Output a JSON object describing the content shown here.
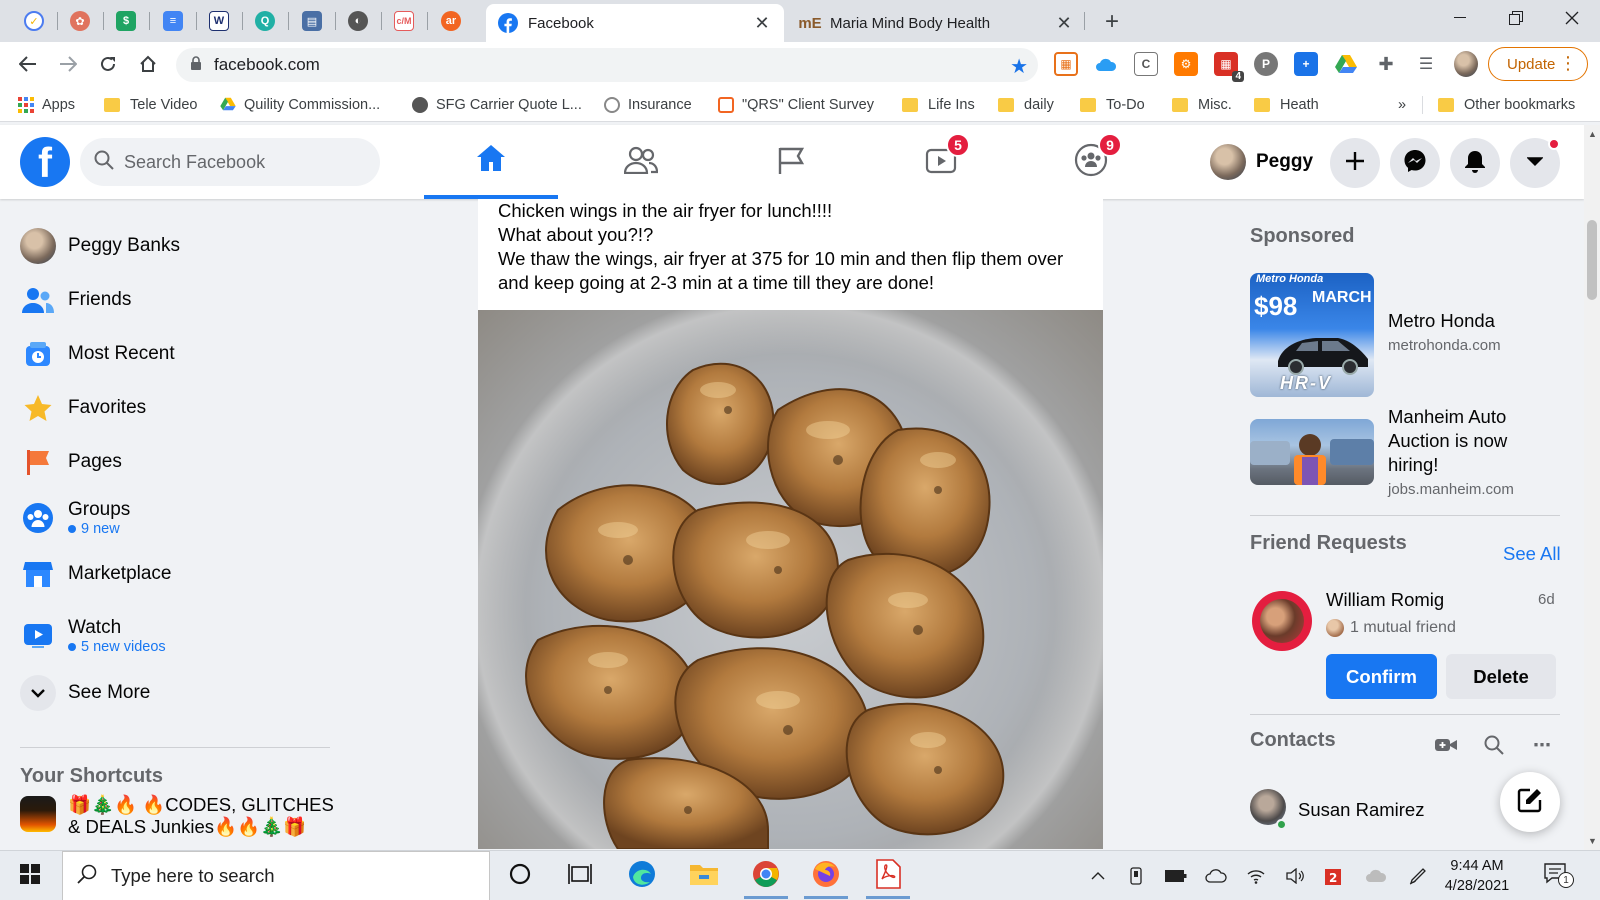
{
  "colors": {
    "fb_blue": "#1877f2",
    "badge_red": "#e41e3f",
    "update_orange": "#e37400"
  },
  "browser": {
    "pinned_tabs": [
      {
        "icon": "check-circle-icon",
        "color": "#4c7cf0"
      },
      {
        "icon": "brain-icon",
        "color": "#e0735e"
      },
      {
        "icon": "dollar-icon",
        "color": "#1fa463"
      },
      {
        "icon": "docs-icon",
        "color": "#4285f4"
      },
      {
        "icon": "w-logo-icon",
        "color": "#1d2f6f"
      },
      {
        "icon": "q-logo-icon",
        "color": "#21b0a5"
      },
      {
        "icon": "news-icon",
        "color": "#4a6fa5"
      },
      {
        "icon": "globe-icon",
        "color": "#555555"
      },
      {
        "icon": "cvm-icon",
        "color": "#e55b5b"
      },
      {
        "icon": "ar-icon",
        "color": "#f26522"
      }
    ],
    "tabs": [
      {
        "title": "Facebook",
        "active": true
      },
      {
        "title": "Maria Mind Body Health",
        "active": false,
        "favicon_text": "mE"
      }
    ],
    "url": "facebook.com",
    "update_label": "Update",
    "bookmarks": [
      {
        "label": "Apps",
        "icon": "apps-grid-icon"
      },
      {
        "label": "Tele Video",
        "icon": "folder-icon"
      },
      {
        "label": "Quility Commission...",
        "icon": "drive-icon"
      },
      {
        "label": "SFG Carrier Quote L...",
        "icon": "globe-icon"
      },
      {
        "label": "Insurance",
        "icon": "globe-icon"
      },
      {
        "label": "\"QRS\" Client Survey",
        "icon": "survey-icon"
      },
      {
        "label": "Life Ins",
        "icon": "folder-icon"
      },
      {
        "label": "daily",
        "icon": "folder-icon"
      },
      {
        "label": "To-Do",
        "icon": "folder-icon"
      },
      {
        "label": "Misc.",
        "icon": "folder-icon"
      },
      {
        "label": "Heath",
        "icon": "folder-icon"
      }
    ],
    "more_bookmarks": "»",
    "other_bookmarks": "Other bookmarks",
    "extension_badge": "4"
  },
  "fb": {
    "search_placeholder": "Search Facebook",
    "nav": [
      {
        "name": "home",
        "badge": null
      },
      {
        "name": "friends",
        "badge": null
      },
      {
        "name": "pages",
        "badge": null
      },
      {
        "name": "watch",
        "badge": "5"
      },
      {
        "name": "groups",
        "badge": "9"
      }
    ],
    "profile_name": "Peggy"
  },
  "sidebar": {
    "items": [
      {
        "label": "Peggy Banks",
        "icon": "avatar"
      },
      {
        "label": "Friends",
        "icon": "friends-icon"
      },
      {
        "label": "Most Recent",
        "icon": "most-recent-icon"
      },
      {
        "label": "Favorites",
        "icon": "star-icon"
      },
      {
        "label": "Pages",
        "icon": "flag-icon"
      },
      {
        "label": "Groups",
        "icon": "groups-icon",
        "sub": "9 new"
      },
      {
        "label": "Marketplace",
        "icon": "marketplace-icon"
      },
      {
        "label": "Watch",
        "icon": "watch-icon",
        "sub": "5 new videos"
      },
      {
        "label": "See More",
        "icon": "chevron-down-icon"
      }
    ],
    "shortcuts_heading": "Your Shortcuts",
    "shortcut": "🎁🎄🔥 🔥CODES, GLITCHES & DEALS Junkies🔥🔥🎄🎁"
  },
  "post": {
    "lines": [
      "Chicken wings in the air fryer for lunch!!!!",
      "What about you?!?",
      "We thaw the wings, air fryer at 375 for 10 min and then flip them over and keep going at 2-3 min at a time till they are done!"
    ]
  },
  "right": {
    "sponsored_heading": "Sponsored",
    "ads": [
      {
        "title": "Metro Honda",
        "url": "metrohonda.com",
        "img_brand": "Metro Honda",
        "img_month": "MARCH",
        "img_price": "$98",
        "img_model": "HR-V"
      },
      {
        "title": "Manheim Auto Auction is now hiring!",
        "url": "jobs.manheim.com"
      }
    ],
    "friend_requests_heading": "Friend Requests",
    "see_all": "See All",
    "request": {
      "name": "William Romig",
      "time": "6d",
      "mutual": "1 mutual friend",
      "confirm": "Confirm",
      "delete": "Delete"
    },
    "contacts_heading": "Contacts",
    "contacts": [
      {
        "name": "Susan Ramirez",
        "online": true
      }
    ]
  },
  "taskbar": {
    "search_placeholder": "Type here to search",
    "time": "9:44 AM",
    "date": "4/28/2021",
    "notification_count": "1",
    "apps": [
      "cortana-icon",
      "task-view-icon",
      "edge-icon",
      "file-explorer-icon",
      "chrome-icon",
      "firefox-icon",
      "pdf-icon"
    ]
  }
}
